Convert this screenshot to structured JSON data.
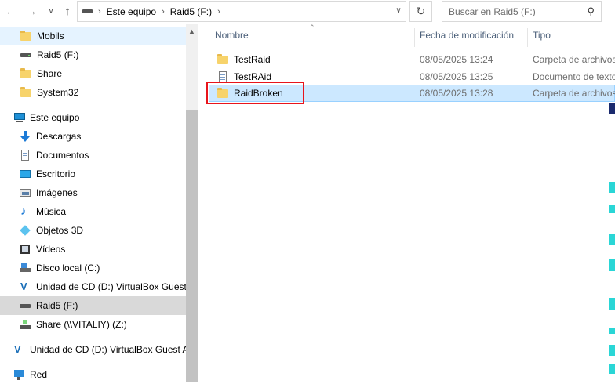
{
  "address_bar": {
    "back_icon": "back-arrow-icon",
    "forward_icon": "forward-arrow-icon",
    "recent_icon": "chevron-down-icon",
    "up_icon": "up-arrow-icon",
    "crumbs": [
      "Este equipo",
      "Raid5 (F:)"
    ],
    "refresh_icon": "refresh-icon",
    "search_placeholder": "Buscar en Raid5 (F:)"
  },
  "nav_items": [
    {
      "label": "Mobils",
      "icon": "folder-icon"
    },
    {
      "label": "Raid5 (F:)",
      "icon": "drive-icon"
    },
    {
      "label": "Share",
      "icon": "folder-icon"
    },
    {
      "label": "System32",
      "icon": "folder-icon"
    },
    {
      "label": "Este equipo",
      "icon": "computer-icon"
    },
    {
      "label": "Descargas",
      "icon": "download-icon"
    },
    {
      "label": "Documentos",
      "icon": "documents-icon"
    },
    {
      "label": "Escritorio",
      "icon": "desktop-icon"
    },
    {
      "label": "Imágenes",
      "icon": "pictures-icon"
    },
    {
      "label": "Música",
      "icon": "music-icon"
    },
    {
      "label": "Objetos 3D",
      "icon": "objects-3d-icon"
    },
    {
      "label": "Vídeos",
      "icon": "videos-icon"
    },
    {
      "label": "Disco local (C:)",
      "icon": "local-disk-icon"
    },
    {
      "label": "Unidad de CD (D:) VirtualBox Guest Additions",
      "icon": "virtualbox-cd-icon"
    },
    {
      "label": "Raid5 (F:)",
      "icon": "drive-icon"
    },
    {
      "label": "Share (\\\\VITALIY) (Z:)",
      "icon": "network-drive-icon"
    },
    {
      "label": "Unidad de CD (D:) VirtualBox Guest Additions",
      "icon": "virtualbox-cd-icon"
    },
    {
      "label": "Red",
      "icon": "network-icon"
    }
  ],
  "columns": {
    "name": "Nombre",
    "date": "Fecha de modificación",
    "type": "Tipo"
  },
  "files": [
    {
      "name": "TestRaid",
      "date": "08/05/2025 13:24",
      "type": "Carpeta de archivos",
      "icon": "folder-icon"
    },
    {
      "name": "TestRAid",
      "date": "08/05/2025 13:25",
      "type": "Documento de texto",
      "icon": "text-document-icon"
    },
    {
      "name": "RaidBroken",
      "date": "08/05/2025 13:28",
      "type": "Carpeta de archivos",
      "icon": "folder-icon"
    }
  ],
  "colors": {
    "selection_bg": "#cce8ff",
    "selection_border": "#99d1ff",
    "highlight_box": "#e8141b",
    "nav_selected_bg": "#d9d9d9"
  }
}
